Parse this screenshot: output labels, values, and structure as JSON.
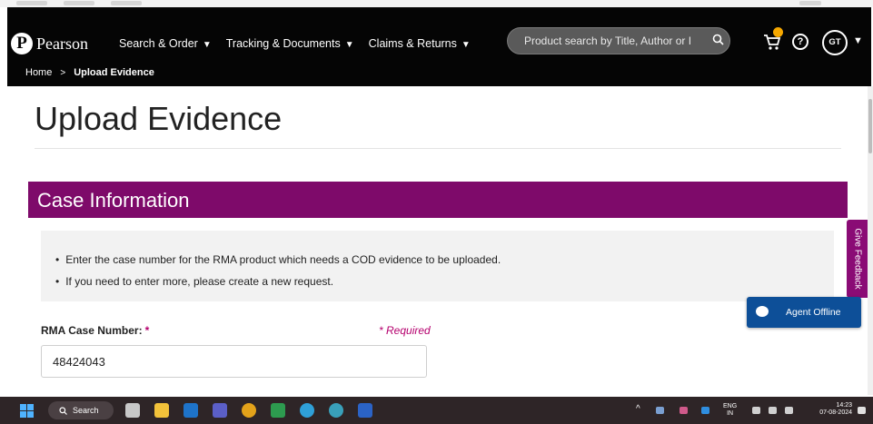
{
  "header": {
    "logo_text": "Pearson",
    "logo_mark": "P",
    "nav": [
      {
        "label": "Search & Order"
      },
      {
        "label": "Tracking & Documents"
      },
      {
        "label": "Claims & Returns"
      }
    ],
    "search_placeholder": "Product search by Title, Author or I",
    "user_initials": "GT",
    "cart_icon": "cart-icon",
    "help_icon": "help-icon",
    "help_glyph": "?"
  },
  "breadcrumb": {
    "items": [
      "Home",
      "Upload Evidence"
    ],
    "separator": ">"
  },
  "main": {
    "title": "Upload Evidence",
    "section_title": "Case Information",
    "instructions": [
      "Enter the case number for the RMA product which needs a COD evidence to be uploaded.",
      "If you need to enter more, please create a new request."
    ],
    "field_label": "RMA Case Number:",
    "required_star": "*",
    "required_note": "* Required",
    "case_number_value": "48424043"
  },
  "widgets": {
    "feedback_label": "Give Feedback",
    "agent_status": "Agent Offline"
  },
  "taskbar": {
    "search_label": "Search",
    "language": "ENG",
    "region": "IN",
    "time": "14:23",
    "date": "07-08-2024"
  },
  "colors": {
    "header_bg": "#050505",
    "section_bar": "#7e0a6a",
    "required_accent": "#b5006e",
    "feedback_tab": "#8a0b75",
    "agent_widget": "#0d4f98",
    "cart_badge": "#f6a800",
    "taskbar_bg": "#2e2527"
  }
}
